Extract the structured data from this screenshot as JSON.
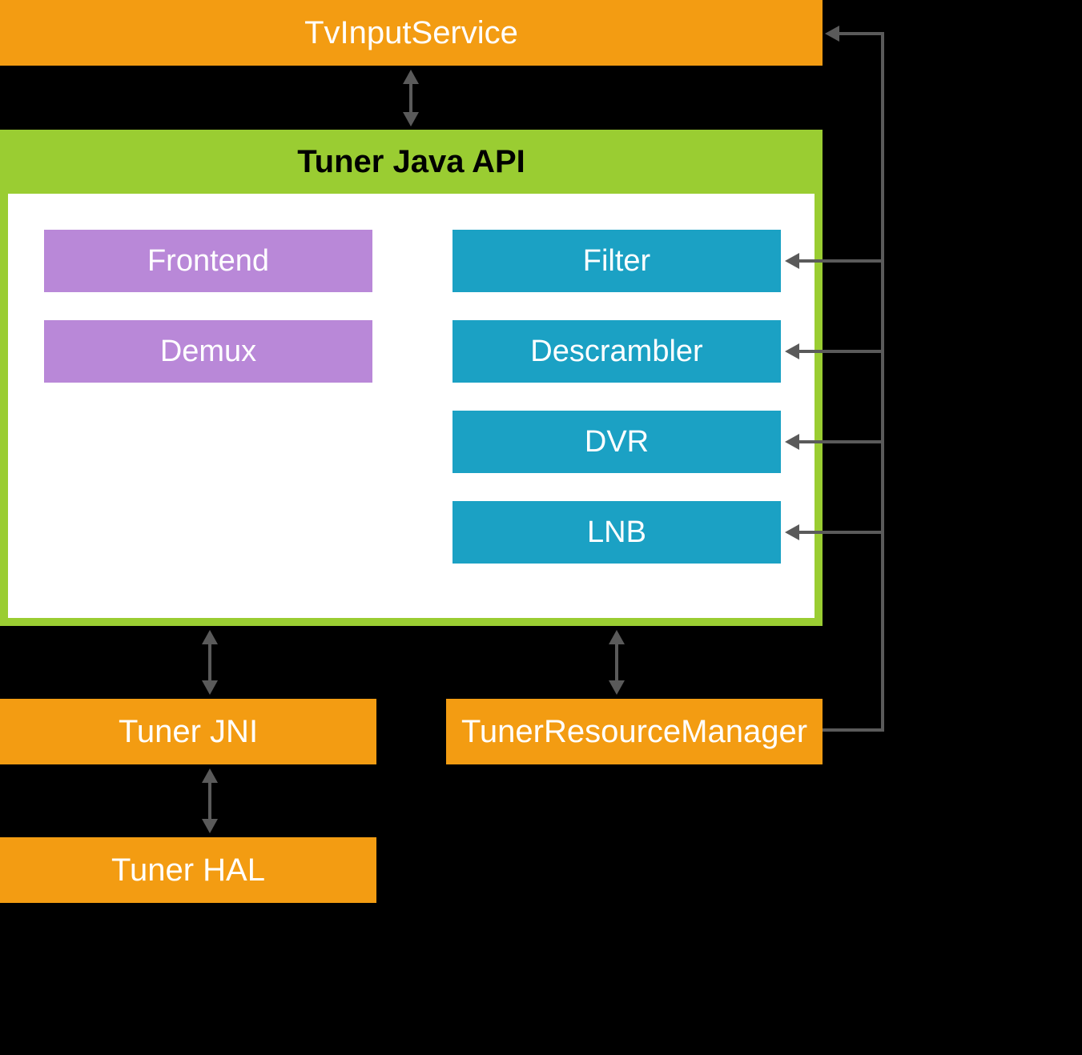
{
  "diagram": {
    "tvInputService": "TvInputService",
    "tunerJavaApi": "Tuner Java API",
    "frontend": "Frontend",
    "demux": "Demux",
    "filter": "Filter",
    "descrambler": "Descrambler",
    "dvr": "DVR",
    "lnb": "LNB",
    "tunerJni": "Tuner JNI",
    "tunerResourceManager": "TunerResourceManager",
    "tunerHal": "Tuner HAL"
  },
  "colors": {
    "orange": "#f39c12",
    "green": "#9acd32",
    "purple": "#b988d8",
    "blue": "#1ba1c4",
    "background": "#000000",
    "arrow": "#5a5a5a"
  }
}
